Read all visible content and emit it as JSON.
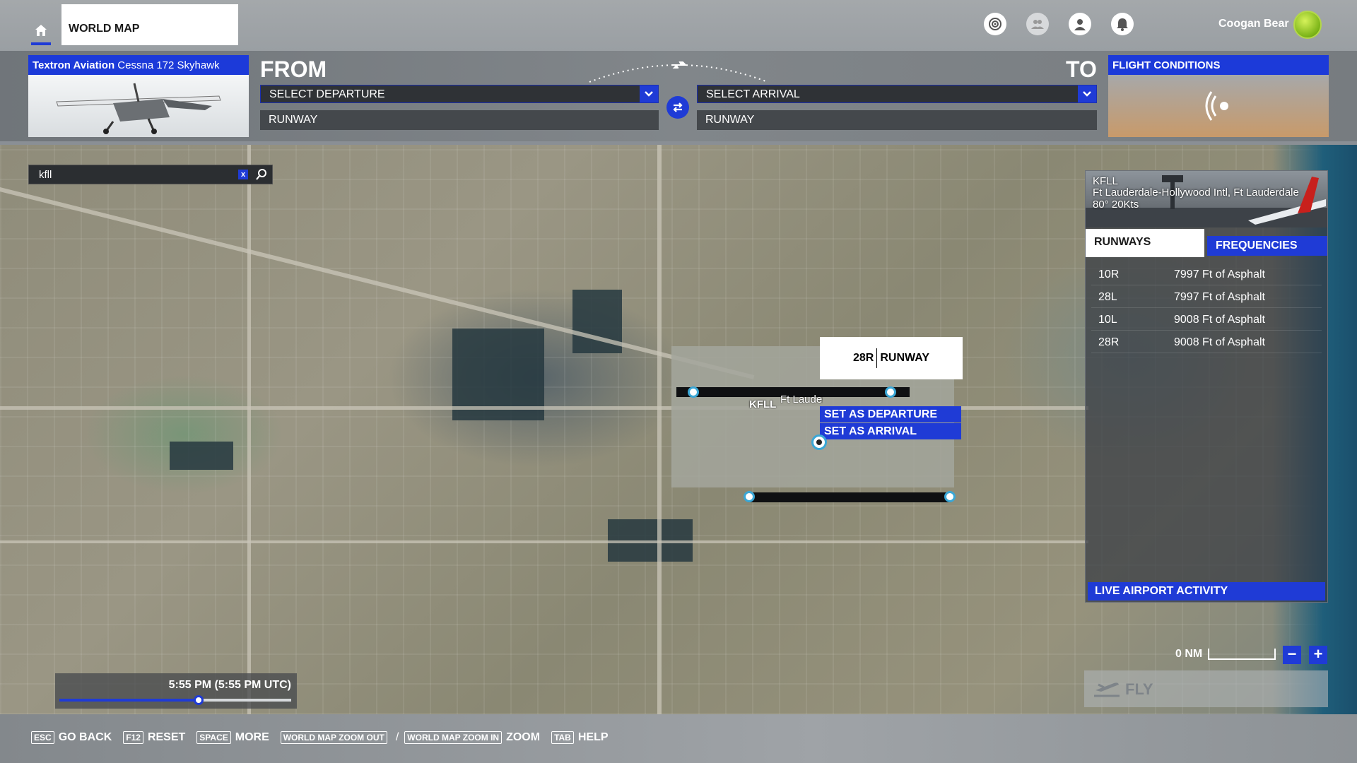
{
  "topnav": {
    "tab_label": "WORLD MAP",
    "user_name": "Coogan Bear",
    "icons": [
      "home-icon",
      "activity-icon",
      "friends-icon",
      "profile-icon",
      "notifications-icon"
    ]
  },
  "flight": {
    "aircraft_brand": "Textron Aviation",
    "aircraft_model": "Cessna 172 Skyhawk",
    "from_label": "FROM",
    "to_label": "TO",
    "departure_placeholder": "SELECT DEPARTURE",
    "arrival_placeholder": "SELECT ARRIVAL",
    "departure_runway": "RUNWAY",
    "arrival_runway": "RUNWAY",
    "conditions_label": "FLIGHT CONDITIONS"
  },
  "search": {
    "value": "kfll",
    "clear_label": "x"
  },
  "map": {
    "tooltip_code": "28R",
    "tooltip_label": "RUNWAY",
    "marker_code": "KFLL",
    "marker_name": "Ft Lauderdale-Hollywood",
    "context_menu": [
      "SET AS DEPARTURE",
      "SET AS ARRIVAL"
    ]
  },
  "airport": {
    "code": "KFLL",
    "name": "Ft Lauderdale-Hollywood Intl, Ft Lauderdale",
    "weather": "80° 20Kts",
    "tabs": [
      "RUNWAYS",
      "FREQUENCIES"
    ],
    "runways": [
      {
        "code": "10R",
        "length": "7997 Ft of Asphalt"
      },
      {
        "code": "28L",
        "length": "7997 Ft of Asphalt"
      },
      {
        "code": "10L",
        "length": "9008 Ft of Asphalt"
      },
      {
        "code": "28R",
        "length": "9008 Ft of Asphalt"
      }
    ],
    "live_activity": "LIVE AIRPORT ACTIVITY"
  },
  "scale": {
    "label": "0 NM"
  },
  "zoom": {
    "minus": "−",
    "plus": "+"
  },
  "fly": {
    "label": "FLY"
  },
  "time": {
    "label": "5:55 PM (5:55 PM UTC)",
    "progress": 0.6
  },
  "hints": [
    {
      "key": "ESC",
      "label": "GO BACK"
    },
    {
      "key": "F12",
      "label": "RESET"
    },
    {
      "key": "SPACE",
      "label": "MORE"
    },
    {
      "key": "WORLD MAP ZOOM OUT",
      "label": ""
    },
    {
      "key": "WORLD MAP ZOOM IN",
      "label": "ZOOM"
    },
    {
      "key": "TAB",
      "label": "HELP"
    }
  ],
  "colors": {
    "accent": "#1f3bd6",
    "panel_dark": "#2f3236",
    "marker_ring": "#3aa7d6"
  }
}
